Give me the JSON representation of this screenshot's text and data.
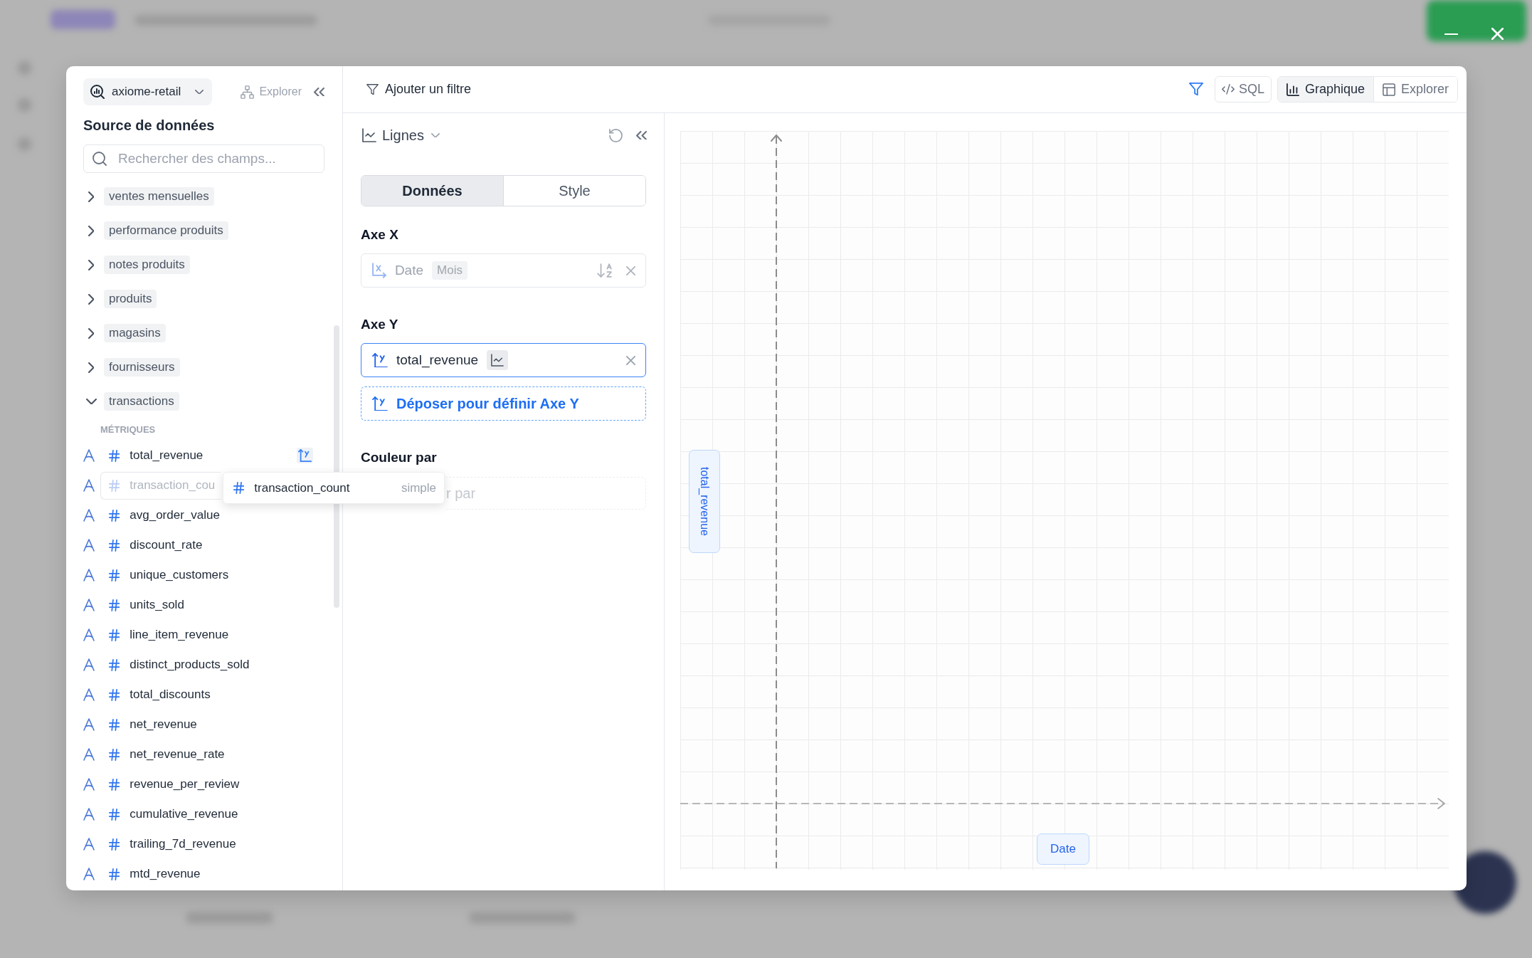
{
  "sidebar": {
    "datasource": "axiome-retail",
    "explorer_link": "Explorer",
    "title": "Source de données",
    "search": {
      "placeholder": "Rechercher des champs..."
    },
    "tables": [
      {
        "label": "ventes mensuelles",
        "expanded": false
      },
      {
        "label": "performance produits",
        "expanded": false
      },
      {
        "label": "notes produits",
        "expanded": false
      },
      {
        "label": "produits",
        "expanded": false
      },
      {
        "label": "magasins",
        "expanded": false
      },
      {
        "label": "fournisseurs",
        "expanded": false
      },
      {
        "label": "transactions",
        "expanded": true,
        "section": "MÉTRIQUES",
        "fields": [
          {
            "name": "total_revenue",
            "on_y_axis": true,
            "dragging": false
          },
          {
            "name": "transaction_cou",
            "on_y_axis": false,
            "dragging": true
          },
          {
            "name": "avg_order_value",
            "on_y_axis": false,
            "dragging": false
          },
          {
            "name": "discount_rate",
            "on_y_axis": false,
            "dragging": false
          },
          {
            "name": "unique_customers",
            "on_y_axis": false,
            "dragging": false
          },
          {
            "name": "units_sold",
            "on_y_axis": false,
            "dragging": false
          },
          {
            "name": "line_item_revenue",
            "on_y_axis": false,
            "dragging": false
          },
          {
            "name": "distinct_products_sold",
            "on_y_axis": false,
            "dragging": false
          },
          {
            "name": "total_discounts",
            "on_y_axis": false,
            "dragging": false
          },
          {
            "name": "net_revenue",
            "on_y_axis": false,
            "dragging": false
          },
          {
            "name": "net_revenue_rate",
            "on_y_axis": false,
            "dragging": false
          },
          {
            "name": "revenue_per_review",
            "on_y_axis": false,
            "dragging": false
          },
          {
            "name": "cumulative_revenue",
            "on_y_axis": false,
            "dragging": false
          },
          {
            "name": "trailing_7d_revenue",
            "on_y_axis": false,
            "dragging": false
          },
          {
            "name": "mtd_revenue",
            "on_y_axis": false,
            "dragging": false
          }
        ]
      }
    ]
  },
  "drag_preview": {
    "name": "transaction_count",
    "hint": "simple"
  },
  "toolbar": {
    "add_filter": "Ajouter un filtre",
    "sql": "SQL",
    "views": [
      {
        "label": "Graphique",
        "kind": "chart",
        "selected": true
      },
      {
        "label": "Explorer",
        "kind": "table",
        "selected": false
      }
    ]
  },
  "chart_config": {
    "chart_type": "Lignes",
    "tabs": [
      {
        "label": "Données",
        "selected": true
      },
      {
        "label": "Style",
        "selected": false
      }
    ],
    "x_axis": {
      "title": "Axe X",
      "field": "Date",
      "granularity": "Mois",
      "dimmed": true
    },
    "y_axis": {
      "title": "Axe Y",
      "fields": [
        {
          "name": "total_revenue",
          "highlighted": true
        }
      ],
      "drop_zone": "Déposer pour définir Axe Y"
    },
    "color_by": {
      "title": "Couleur par",
      "placeholder": "r par"
    }
  },
  "chart": {
    "y_label": "total_revenue",
    "x_label": "Date"
  }
}
